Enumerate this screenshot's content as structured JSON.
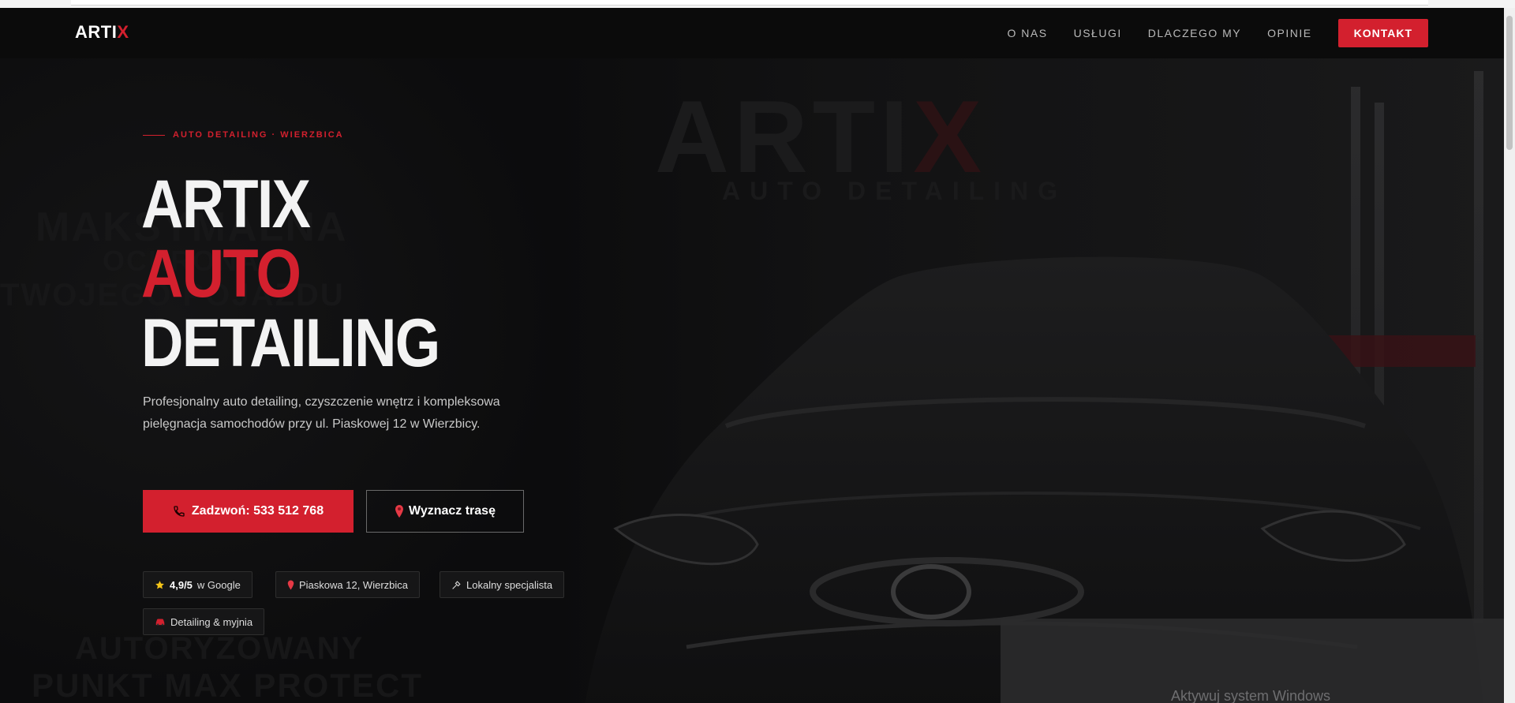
{
  "brand": {
    "name_main": "ARTI",
    "name_accent": "X"
  },
  "nav": {
    "items": [
      "O NAS",
      "USŁUGI",
      "DLACZEGO MY",
      "OPINIE"
    ],
    "cta": "KONTAKT"
  },
  "hero": {
    "eyebrow": "AUTO DETAILING · WIERZBICA",
    "title_line1": "ARTIX",
    "title_line2": "AUTO",
    "title_line3": "DETAILING",
    "lead": "Profesjonalny auto detailing, czyszczenie wnętrz i kompleksowa pielęgnacja samochodów przy ul. Piaskowej 12 w Wierzbicy.",
    "btn_call": "Zadzwoń: 533 512 768",
    "btn_route": "Wyznacz trasę"
  },
  "chips": [
    {
      "icon": "star-icon",
      "strong": "4,9/5",
      "text": "w Google"
    },
    {
      "icon": "pin-icon",
      "text": "Piaskowa 12, Wierzbica"
    },
    {
      "icon": "brush-icon",
      "text": "Lokalny specjalista"
    },
    {
      "icon": "car-icon",
      "text": "Detailing & myjnia"
    }
  ],
  "background": {
    "logo_main": "ARTI",
    "logo_accent": "X",
    "logo_sub": "AUTO DETAILING",
    "left_line1": "MAKSYMALNA",
    "left_line2": "OCHRONA",
    "left_line3": "TWOJEGO POJAZDU",
    "left_line4": "AUTORYZOWANY",
    "left_line5": "PUNKT MAX PROTECT"
  },
  "os_watermark": "Aktywuj system Windows",
  "colors": {
    "accent": "#d3202e",
    "background": "#0b0b0c",
    "text": "#e6e6e6"
  }
}
